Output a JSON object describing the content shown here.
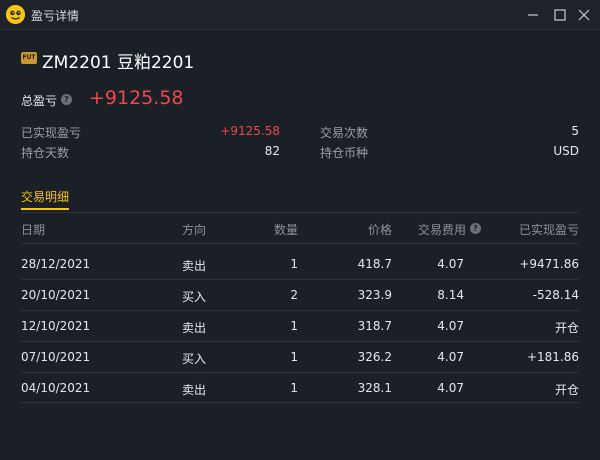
{
  "window": {
    "title": "盈亏详情"
  },
  "header": {
    "badge": "FUT",
    "contract": "ZM2201 豆粕2201",
    "total_label": "总盈亏",
    "total_value": "+9125.58"
  },
  "stats": {
    "realized_label": "已实现盈亏",
    "realized_value": "+9125.58",
    "trades_label": "交易次数",
    "trades_value": "5",
    "days_label": "持仓天数",
    "days_value": "82",
    "currency_label": "持仓币种",
    "currency_value": "USD"
  },
  "tabs": {
    "active": "交易明细"
  },
  "table": {
    "headers": [
      "日期",
      "方向",
      "数量",
      "价格",
      "交易费用",
      "已实现盈亏"
    ],
    "rows": [
      {
        "date": "28/12/2021",
        "side": "卖出",
        "qty": "1",
        "price": "418.7",
        "fee": "4.07",
        "pnl": "+9471.86"
      },
      {
        "date": "20/10/2021",
        "side": "买入",
        "qty": "2",
        "price": "323.9",
        "fee": "8.14",
        "pnl": "-528.14"
      },
      {
        "date": "12/10/2021",
        "side": "卖出",
        "qty": "1",
        "price": "318.7",
        "fee": "4.07",
        "pnl": "开仓"
      },
      {
        "date": "07/10/2021",
        "side": "买入",
        "qty": "1",
        "price": "326.2",
        "fee": "4.07",
        "pnl": "+181.86"
      },
      {
        "date": "04/10/2021",
        "side": "卖出",
        "qty": "1",
        "price": "328.1",
        "fee": "4.07",
        "pnl": "开仓"
      }
    ]
  },
  "colors": {
    "up": "#f0474e",
    "down": "#2ebd72",
    "accent": "#f5c518"
  }
}
